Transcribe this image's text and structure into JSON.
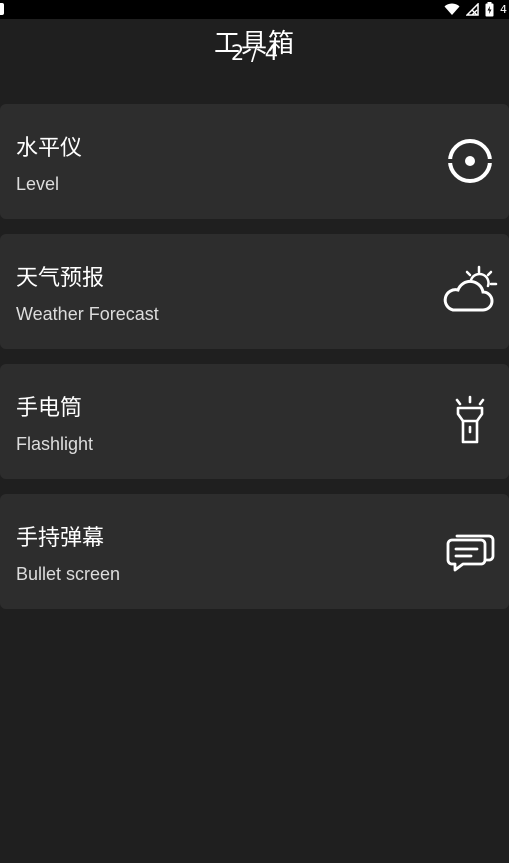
{
  "status_bar": {
    "battery_text": "4"
  },
  "header": {
    "title": "工具箱",
    "page_indicator": "2 / 4"
  },
  "tools": [
    {
      "title": "水平仪",
      "subtitle": "Level",
      "icon": "level-target-icon"
    },
    {
      "title": "天气预报",
      "subtitle": "Weather Forecast",
      "icon": "weather-sun-cloud-icon"
    },
    {
      "title": "手电筒",
      "subtitle": "Flashlight",
      "icon": "flashlight-icon"
    },
    {
      "title": "手持弹幕",
      "subtitle": "Bullet screen",
      "icon": "chat-bubble-icon"
    }
  ],
  "colors": {
    "background": "#1f1f1f",
    "card": "#2d2d2d",
    "status_bar": "#000000",
    "text": "#ffffff"
  }
}
